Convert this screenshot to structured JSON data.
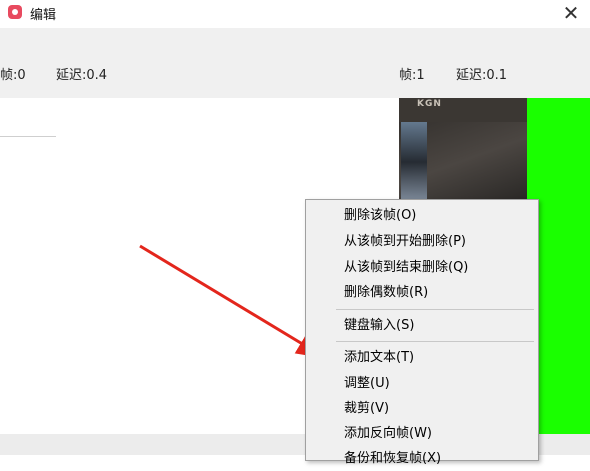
{
  "window": {
    "title": "编辑"
  },
  "toolbar": {
    "left_frame": "帧:0",
    "left_delay": "延迟:0.4",
    "right_frame": "帧:1",
    "right_delay": "延迟:0.1"
  },
  "frame_image": {
    "text": "KGN"
  },
  "context_menu": {
    "items": [
      "删除该帧(O)",
      "从该帧到开始删除(P)",
      "从该帧到结束删除(Q)",
      "删除偶数帧(R)",
      "键盘输入(S)",
      "添加文本(T)",
      "调整(U)",
      "裁剪(V)",
      "添加反向帧(W)",
      "备份和恢复帧(X)"
    ]
  },
  "colors": {
    "accent_green": "#1aff00",
    "arrow_red": "#e3261c",
    "app_icon": "#e84a5f"
  },
  "icons": {
    "app": "app-logo-icon",
    "close": "close-icon"
  }
}
